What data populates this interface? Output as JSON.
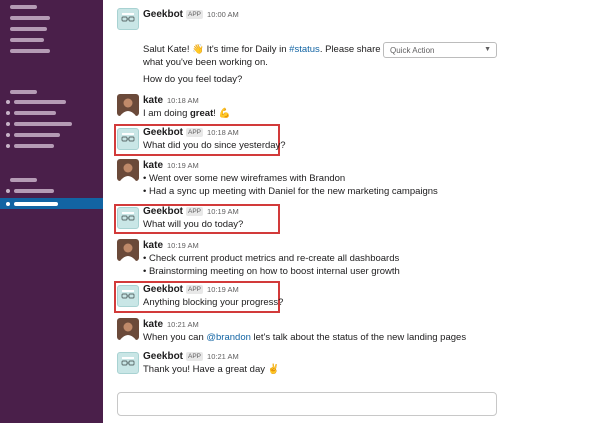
{
  "messages": {
    "m1": {
      "sender": "Geekbot",
      "badge": "APP",
      "time": "10:00 AM",
      "line1_prefix": "Salut Kate! 👋 It's time for Daily in ",
      "channel": "#status",
      "line1_suffix": ". Please share",
      "line2": "what you've been working on.",
      "line3": "How do you feel today?"
    },
    "m2": {
      "sender": "kate",
      "time": "10:18 AM",
      "text_prefix": "I am doing ",
      "text_bold": "great",
      "text_suffix": "! 💪"
    },
    "m3": {
      "sender": "Geekbot",
      "badge": "APP",
      "time": "10:18 AM",
      "text": "What did you do since yesterday?"
    },
    "m4": {
      "sender": "kate",
      "time": "10:19 AM",
      "bullets": [
        "Went over some new wireframes with Brandon",
        "Had a sync up meeting with Daniel for the new marketing campaigns"
      ]
    },
    "m5": {
      "sender": "Geekbot",
      "badge": "APP",
      "time": "10:19 AM",
      "text": "What will you do today?"
    },
    "m6": {
      "sender": "kate",
      "time": "10:19 AM",
      "bullets": [
        "Check current product metrics and re-create all dashboards",
        "Brainstorming meeting on how to boost internal user growth"
      ]
    },
    "m7": {
      "sender": "Geekbot",
      "badge": "APP",
      "time": "10:19 AM",
      "text": "Anything blocking your progress?"
    },
    "m8": {
      "sender": "kate",
      "time": "10:21 AM",
      "text_prefix": "When you can ",
      "mention": "@brandon",
      "text_suffix": " let's talk about the status of the new landing pages"
    },
    "m9": {
      "sender": "Geekbot",
      "badge": "APP",
      "time": "10:21 AM",
      "text": "Thank you! Have a great day ✌️"
    }
  },
  "quick_action": {
    "label": "Quick Action",
    "icon": "chevron-down-icon"
  },
  "colors": {
    "sidebar": "#4a1f4a",
    "active_channel": "#1264a3",
    "link": "#1264a3",
    "highlight": "#d23a3a"
  }
}
